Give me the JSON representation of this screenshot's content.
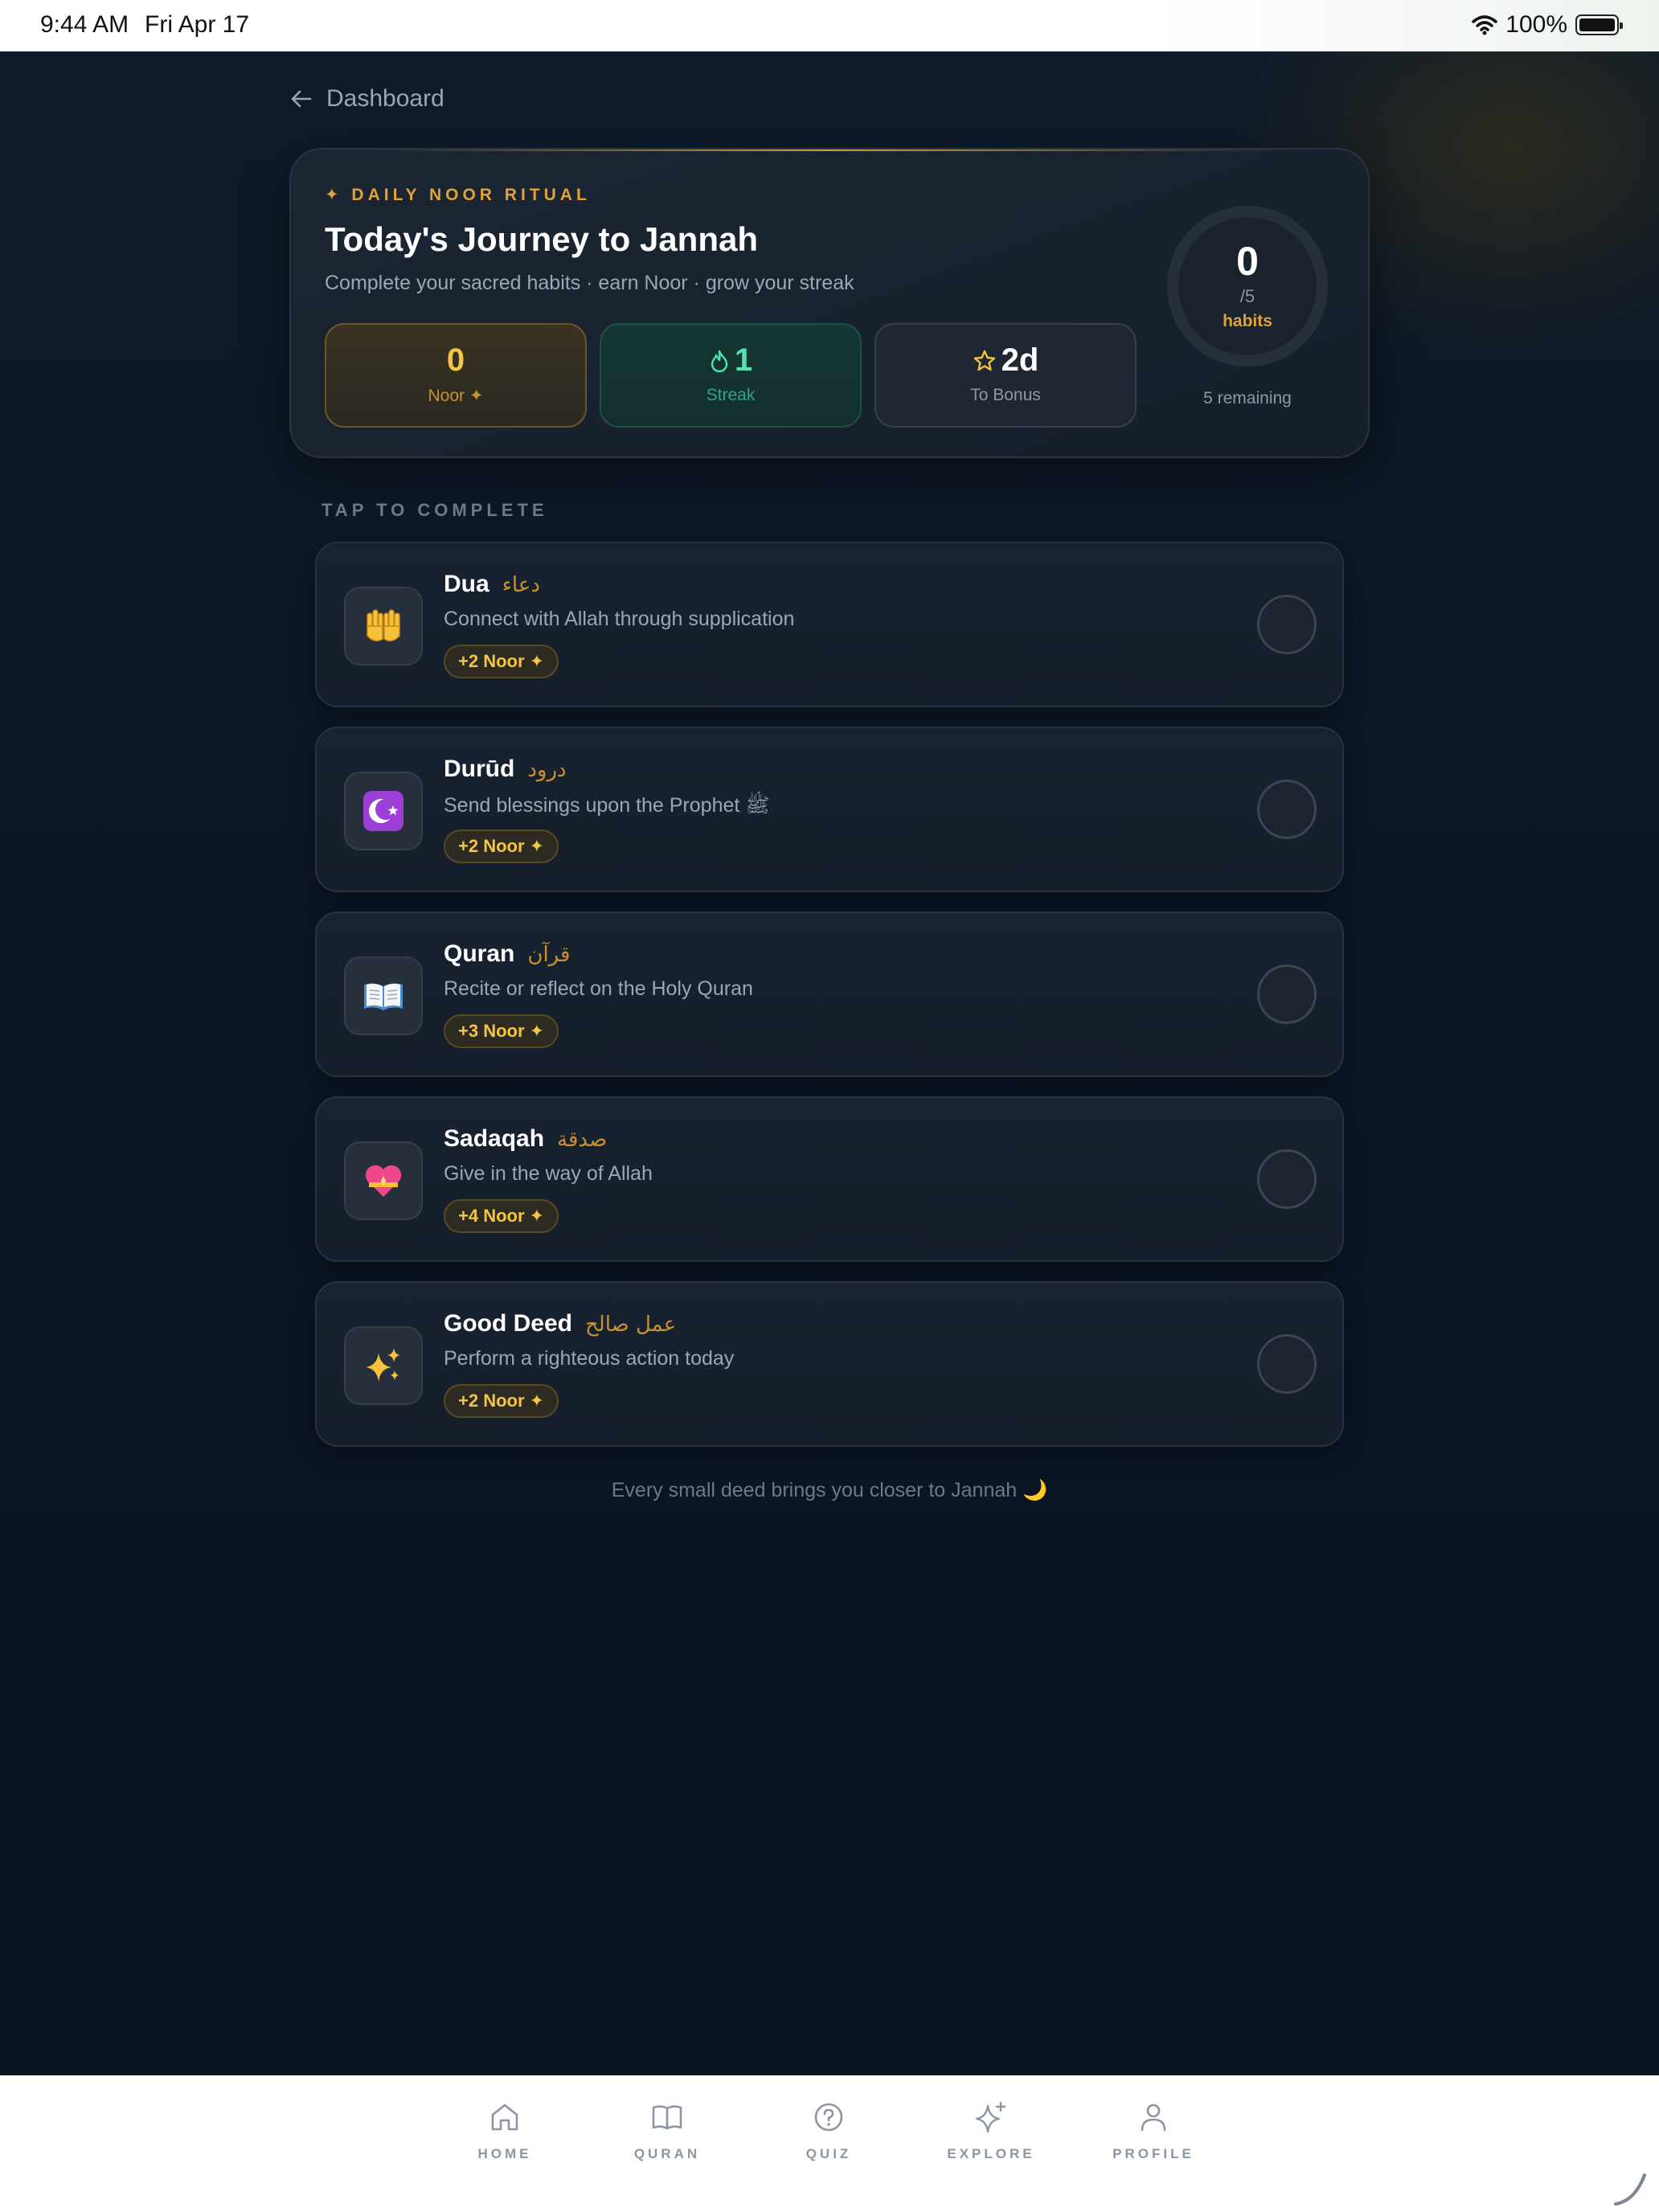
{
  "status_bar": {
    "time": "9:44 AM",
    "date": "Fri Apr 17",
    "battery": "100%"
  },
  "nav": {
    "back_label": "Dashboard"
  },
  "hero": {
    "eyebrow": "✦ DAILY NOOR RITUAL",
    "title": "Today's Journey to Jannah",
    "subtitle": "Complete your sacred habits · earn Noor · grow your streak",
    "stats": {
      "noor": {
        "value": "0",
        "label": "Noor ✦"
      },
      "streak": {
        "value": "1",
        "label": "Streak"
      },
      "bonus": {
        "value": "2d",
        "label": "To Bonus"
      }
    },
    "progress": {
      "completed": "0",
      "total": "/5",
      "label": "habits",
      "remaining": "5 remaining",
      "fraction": 0
    }
  },
  "section_title": "TAP TO COMPLETE",
  "habits": [
    {
      "name": "Dua",
      "arabic": "دعاء",
      "description": "Connect with Allah through supplication",
      "reward": "+2 Noor ✦",
      "icon": "raised-hands-icon",
      "completed": false
    },
    {
      "name": "Durūd",
      "arabic": "درود",
      "description": "Send blessings upon the Prophet ﷺ",
      "reward": "+2 Noor ✦",
      "icon": "crescent-icon",
      "completed": false
    },
    {
      "name": "Quran",
      "arabic": "قرآن",
      "description": "Recite or reflect on the Holy Quran",
      "reward": "+3 Noor ✦",
      "icon": "open-book-icon",
      "completed": false
    },
    {
      "name": "Sadaqah",
      "arabic": "صدقة",
      "description": "Give in the way of Allah",
      "reward": "+4 Noor ✦",
      "icon": "heart-icon",
      "completed": false
    },
    {
      "name": "Good Deed",
      "arabic": "عمل صالح",
      "description": "Perform a righteous action today",
      "reward": "+2 Noor ✦",
      "icon": "sparkles-icon",
      "completed": false
    }
  ],
  "footer_note": "Every small deed brings you closer to Jannah 🌙",
  "tabs": [
    {
      "label": "HOME",
      "icon": "home-icon"
    },
    {
      "label": "QURAN",
      "icon": "book-icon"
    },
    {
      "label": "QUIZ",
      "icon": "question-icon"
    },
    {
      "label": "EXPLORE",
      "icon": "sparkle-icon"
    },
    {
      "label": "PROFILE",
      "icon": "person-icon"
    }
  ],
  "colors": {
    "accent_gold": "#e0a23a",
    "noor_gold": "#f4c542",
    "streak_green": "#54e0b0",
    "background": "#0b1524"
  }
}
